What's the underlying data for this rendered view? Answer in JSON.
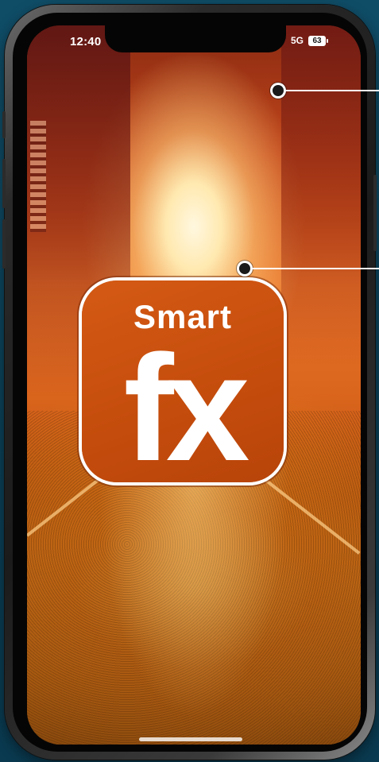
{
  "status_bar": {
    "time": "12:40",
    "network": "5G",
    "battery": "63"
  },
  "app_logo": {
    "top_text": "Smart",
    "main_text": "fx",
    "background_color": "#c44c0c",
    "text_color": "#ffffff"
  },
  "callouts": [
    {
      "icon": "callout-marker"
    },
    {
      "icon": "callout-marker"
    }
  ]
}
